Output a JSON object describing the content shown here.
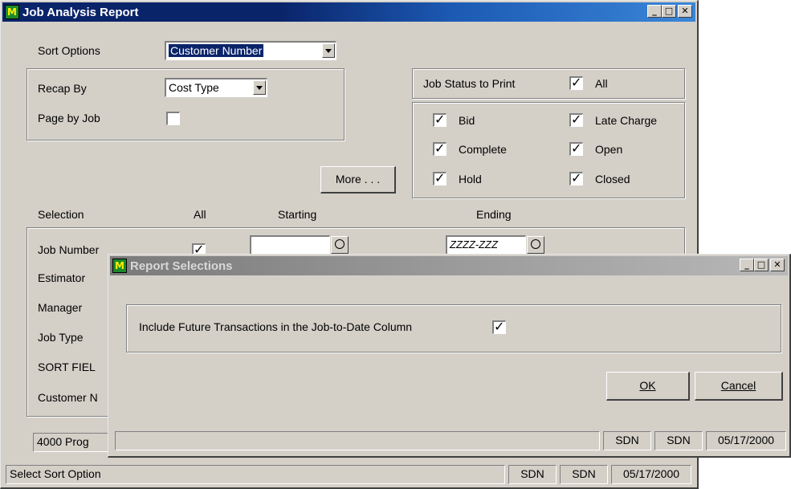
{
  "main_window": {
    "title": "Job Analysis Report",
    "sort_options_label": "Sort Options",
    "sort_options_value": "Customer Number",
    "recap_by_label": "Recap By",
    "recap_by_value": "Cost Type",
    "page_by_job_label": "Page by Job",
    "more_button": "More . . .",
    "job_status_label": "Job Status to Print",
    "status_all_label": "All",
    "statuses": {
      "bid": "Bid",
      "late_charge": "Late Charge",
      "complete": "Complete",
      "open": "Open",
      "hold": "Hold",
      "closed": "Closed"
    },
    "selection_header": {
      "selection": "Selection",
      "all": "All",
      "starting": "Starting",
      "ending": "Ending"
    },
    "selection_rows": [
      "Job Number",
      "Estimator",
      "Manager",
      "Job Type",
      "SORT FIEL",
      "Customer N"
    ],
    "job_number_ending": "ZZZZ-ZZZ",
    "bottom_field": "4000 Prog",
    "status_bar": {
      "message": "Select Sort Option",
      "user1": "SDN",
      "user2": "SDN",
      "date": "05/17/2000"
    }
  },
  "dialog": {
    "title": "Report Selections",
    "include_future_label": "Include Future Transactions in the Job-to-Date Column",
    "ok_button": "OK",
    "cancel_button": "Cancel",
    "status_bar": {
      "user1": "SDN",
      "user2": "SDN",
      "date": "05/17/2000"
    }
  },
  "icons": {
    "app_icon": "M",
    "check_mark": "✓",
    "minimize": "_",
    "maximize": "□",
    "close": "✕"
  },
  "colors": {
    "titlebar_active": "#0a246a",
    "titlebar_inactive": "#8a8a8a",
    "face": "#d4d0c8"
  }
}
